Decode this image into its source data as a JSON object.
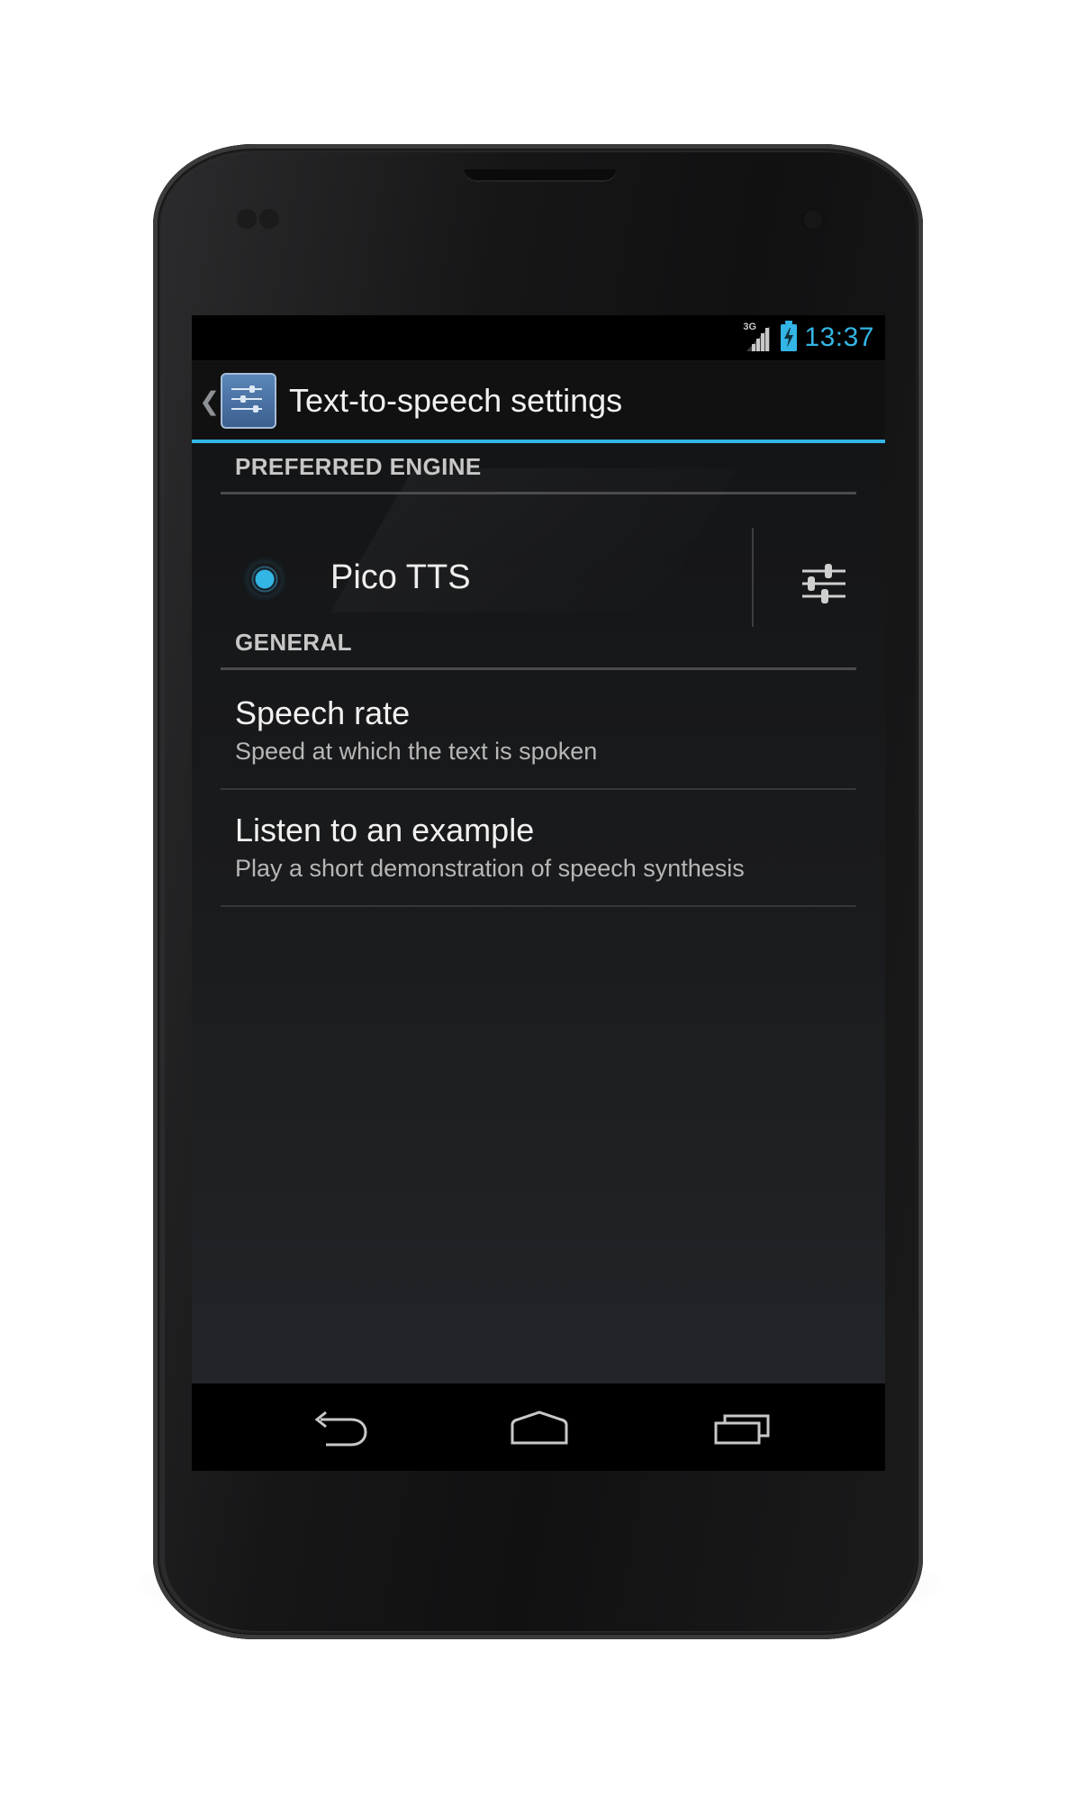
{
  "status_bar": {
    "network_label": "3G",
    "time": "13:37"
  },
  "action_bar": {
    "title": "Text-to-speech settings"
  },
  "preferred_engine_section": {
    "header": "PREFERRED ENGINE",
    "engine_name": "Pico TTS"
  },
  "general_section": {
    "header": "GENERAL",
    "items": [
      {
        "title": "Speech rate",
        "summary": "Speed at which the text is spoken"
      },
      {
        "title": "Listen to an example",
        "summary": "Play a short demonstration of speech synthesis"
      }
    ]
  },
  "icons": {
    "status": [
      "signal-icon",
      "battery-icon"
    ],
    "action_bar": [
      "back-caret-icon",
      "settings-app-icon"
    ],
    "engine": [
      "radio-selected-icon",
      "engine-settings-icon"
    ],
    "navigation": [
      "back-icon",
      "home-icon",
      "recent-apps-icon"
    ]
  },
  "colors": {
    "accent": "#33b5e5",
    "background": "#1a1b1d",
    "text_primary": "#f1f1f1",
    "text_secondary": "#b7b7b7"
  }
}
